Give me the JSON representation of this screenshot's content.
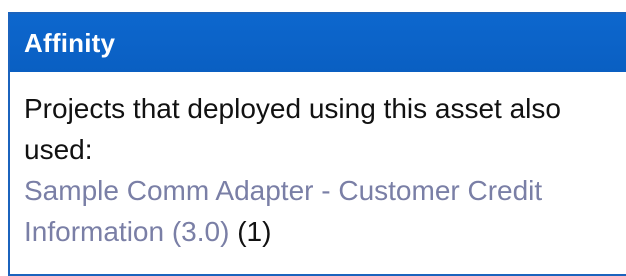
{
  "affinity_panel": {
    "title": "Affinity",
    "intro": "Projects that deployed using this asset also used:",
    "items": [
      {
        "link_text": "Sample Comm Adapter - Customer Credit Information (3.0)",
        "count": "(1)"
      }
    ]
  },
  "colors": {
    "header_bg": "#0b63c8",
    "header_text": "#ffffff",
    "link": "#7a7fa6",
    "body_text": "#111111"
  }
}
